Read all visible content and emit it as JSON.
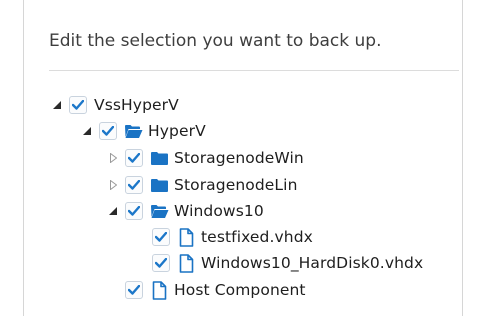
{
  "heading": "Edit the selection you want to back up.",
  "tree": [
    {
      "label": "VssHyperV",
      "toggle": "expanded",
      "checked": true,
      "type": "root"
    },
    {
      "label": "HyperV",
      "toggle": "expanded",
      "checked": true,
      "type": "folder-open"
    },
    {
      "label": "StoragenodeWin",
      "toggle": "collapsed",
      "checked": true,
      "type": "folder-closed"
    },
    {
      "label": "StoragenodeLin",
      "toggle": "collapsed",
      "checked": true,
      "type": "folder-closed"
    },
    {
      "label": "Windows10",
      "toggle": "expanded",
      "checked": true,
      "type": "folder-open"
    },
    {
      "label": "testfixed.vhdx",
      "toggle": "none",
      "checked": true,
      "type": "file"
    },
    {
      "label": "Windows10_HardDisk0.vhdx",
      "toggle": "none",
      "checked": true,
      "type": "file"
    },
    {
      "label": "Host Component",
      "toggle": "none",
      "checked": true,
      "type": "file"
    }
  ],
  "colors": {
    "accent": "#1a73c4",
    "checkmark": "#1c77c9",
    "toggle": "#2a2a2a",
    "toggle_collapsed": "#9a9a9a"
  }
}
